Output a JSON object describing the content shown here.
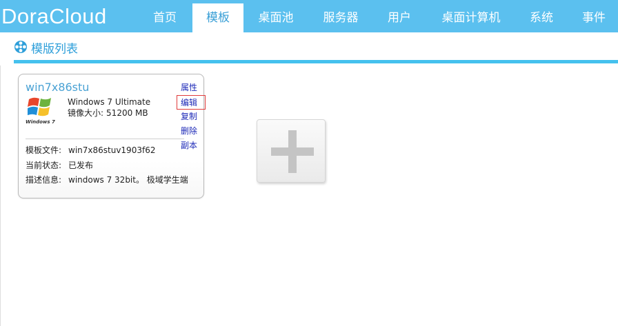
{
  "app": {
    "logo": "DoraCloud"
  },
  "nav": {
    "items": [
      {
        "label": "首页"
      },
      {
        "label": "模板"
      },
      {
        "label": "桌面池"
      },
      {
        "label": "服务器"
      },
      {
        "label": "用户"
      },
      {
        "label": "桌面计算机"
      },
      {
        "label": "系统"
      },
      {
        "label": "事件"
      }
    ],
    "active": "模板"
  },
  "page": {
    "section_title": "模版列表",
    "section_icon": "film-reel-icon"
  },
  "templates": [
    {
      "name": "win7x86stu",
      "os_logo_text": "Windows 7",
      "os_name": "Windows 7 Ultimate",
      "size_label": "镜像大小:",
      "size_value": "51200 MB",
      "actions": [
        {
          "label": "属性"
        },
        {
          "label": "编辑"
        },
        {
          "label": "复制"
        },
        {
          "label": "删除"
        },
        {
          "label": "副本"
        }
      ],
      "selected_action": "编辑",
      "info": [
        {
          "key": "模板文件:",
          "value": "win7x86stuv1903f62"
        },
        {
          "key": "当前状态:",
          "value": "已发布"
        },
        {
          "key": "描述信息:",
          "value": "windows 7 32bit。 极域学生端"
        }
      ]
    }
  ],
  "add_button": {
    "icon": "plus-icon"
  },
  "colors": {
    "topbar": "#5bc0ef",
    "accent": "#2e9fda",
    "link": "#1f2bb8",
    "highlight": "#e03a3a"
  }
}
